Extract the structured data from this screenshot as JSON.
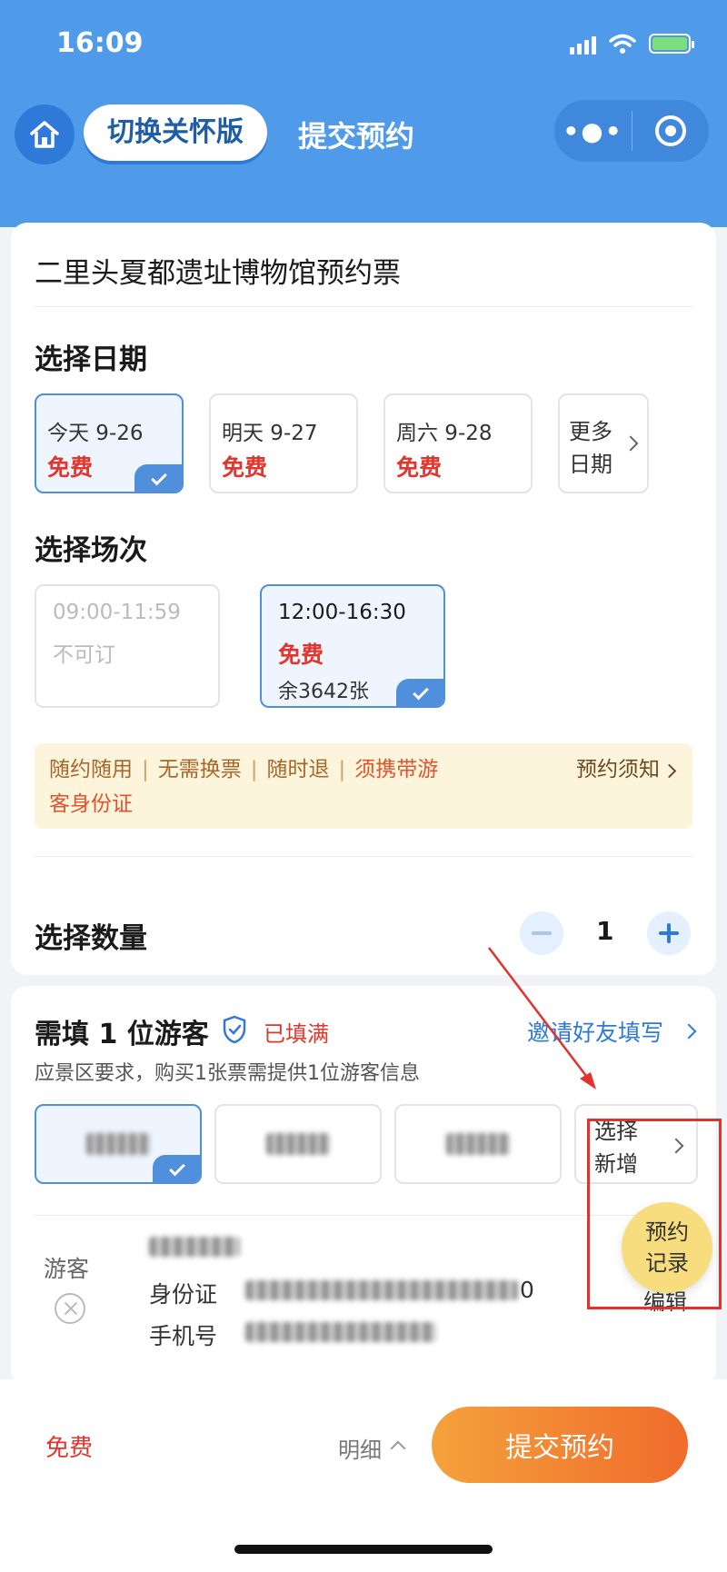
{
  "status_bar": {
    "time": "16:09"
  },
  "nav": {
    "care_mode_label": "切换关怀版",
    "title": "提交预约",
    "more_icon": "more-dots-icon",
    "close_icon": "target-circle-icon"
  },
  "ticket": {
    "title": "二里头夏都遗址博物馆预约票"
  },
  "date_section": {
    "title": "选择日期",
    "options": [
      {
        "label": "今天 9-26",
        "price": "免费",
        "selected": true
      },
      {
        "label": "明天 9-27",
        "price": "免费",
        "selected": false
      },
      {
        "label": "周六 9-28",
        "price": "免费",
        "selected": false
      }
    ],
    "more_label_line1": "更多",
    "more_label_line2": "日期"
  },
  "session_section": {
    "title": "选择场次",
    "options": [
      {
        "time": "09:00-11:59",
        "status": "不可订",
        "remaining": "",
        "selected": false,
        "disabled": true
      },
      {
        "time": "12:00-16:30",
        "status": "免费",
        "remaining": "余3642张",
        "selected": true,
        "disabled": false
      }
    ]
  },
  "notice": {
    "tag1": "随约随用",
    "tag2": "无需换票",
    "tag3": "随时退",
    "tag4_line1": "须携带游",
    "tag4_line2": "客身份证",
    "link": "预约须知"
  },
  "quantity": {
    "title": "选择数量",
    "value": "1"
  },
  "visitors": {
    "need_title": "需填 1 位游客",
    "filled_status": "已填满",
    "invite_link": "邀请好友填写",
    "description": "应景区要求，购买1张票需提供1位游客信息",
    "new_line1": "选择",
    "new_line2": "新增",
    "detail_label": "游客",
    "id_label": "身份证",
    "id_suffix": "0",
    "phone_label": "手机号",
    "edit_label": "编辑"
  },
  "floating": {
    "records_label": "预约\n记录"
  },
  "footer": {
    "total": "免费",
    "detail_label": "明细",
    "submit_label": "提交预约"
  },
  "colors": {
    "brand_blue": "#4f9bea",
    "price_red": "#e0362d",
    "submit_start": "#f4a23c",
    "submit_end": "#f06b2b",
    "annotation_red": "#e3312b"
  }
}
